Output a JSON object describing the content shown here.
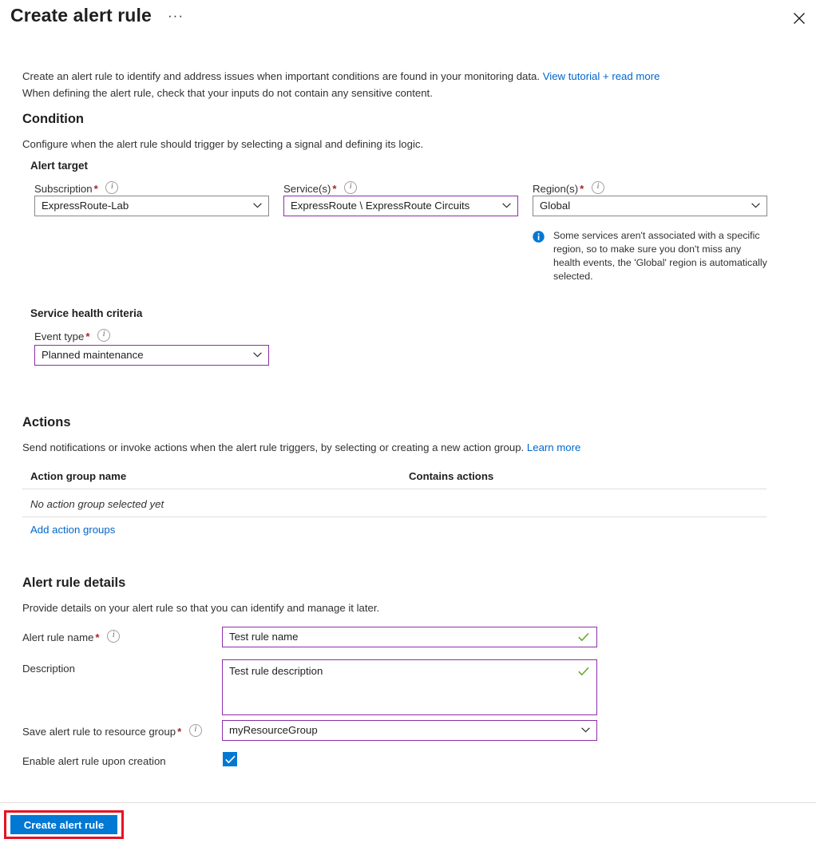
{
  "blade": {
    "title": "Create alert rule",
    "ellipsis_label": "···",
    "close_label": "Close"
  },
  "intro": {
    "line1": "Create an alert rule to identify and address issues when important conditions are found in your monitoring data.",
    "line1_link": "View tutorial + read more",
    "line2": "When defining the alert rule, check that your inputs do not contain any sensitive content."
  },
  "condition": {
    "heading": "Condition",
    "description": "Configure when the alert rule should trigger by selecting a signal and defining its logic.",
    "alert_target": {
      "group_label": "Alert target",
      "subscription": {
        "label": "Subscription",
        "required": "*",
        "value": "ExpressRoute-Lab"
      },
      "services": {
        "label": "Service(s)",
        "required": "*",
        "value": "ExpressRoute \\ ExpressRoute Circuits"
      },
      "regions": {
        "label": "Region(s)",
        "required": "*",
        "value": "Global"
      },
      "region_note": "Some services aren't associated with a specific region, so to make sure you don't miss any health events, the 'Global' region is automatically selected."
    },
    "service_health_criteria": {
      "group_label": "Service health criteria",
      "event_type": {
        "label": "Event type",
        "required": "*",
        "value": "Planned maintenance"
      }
    }
  },
  "actions": {
    "heading": "Actions",
    "description": "Send notifications or invoke actions when the alert rule triggers, by selecting or creating a new action group.",
    "description_link": "Learn more",
    "columns": [
      "Action group name",
      "Contains actions"
    ],
    "empty_row": "No action group selected yet",
    "add_link": "Add action groups"
  },
  "alert_rule_details": {
    "heading": "Alert rule details",
    "description": "Provide details on your alert rule so that you can identify and manage it later.",
    "rule_name": {
      "label": "Alert rule name",
      "required": "*",
      "value": "Test rule name"
    },
    "description_field": {
      "label": "Description",
      "value": "Test rule description"
    },
    "resource_group": {
      "label": "Save alert rule to resource group",
      "required": "*",
      "value": "myResourceGroup"
    },
    "enable_rule": {
      "label": "Enable alert rule upon creation",
      "checked": true
    }
  },
  "footer": {
    "create_button": "Create alert rule"
  },
  "colors": {
    "accent_blue": "#0078d4",
    "link_blue": "#0066cc",
    "required_red": "#a4262c",
    "focus_purple": "#8b2fa8",
    "valid_green": "#5fa522",
    "highlight_red": "#e81123"
  }
}
